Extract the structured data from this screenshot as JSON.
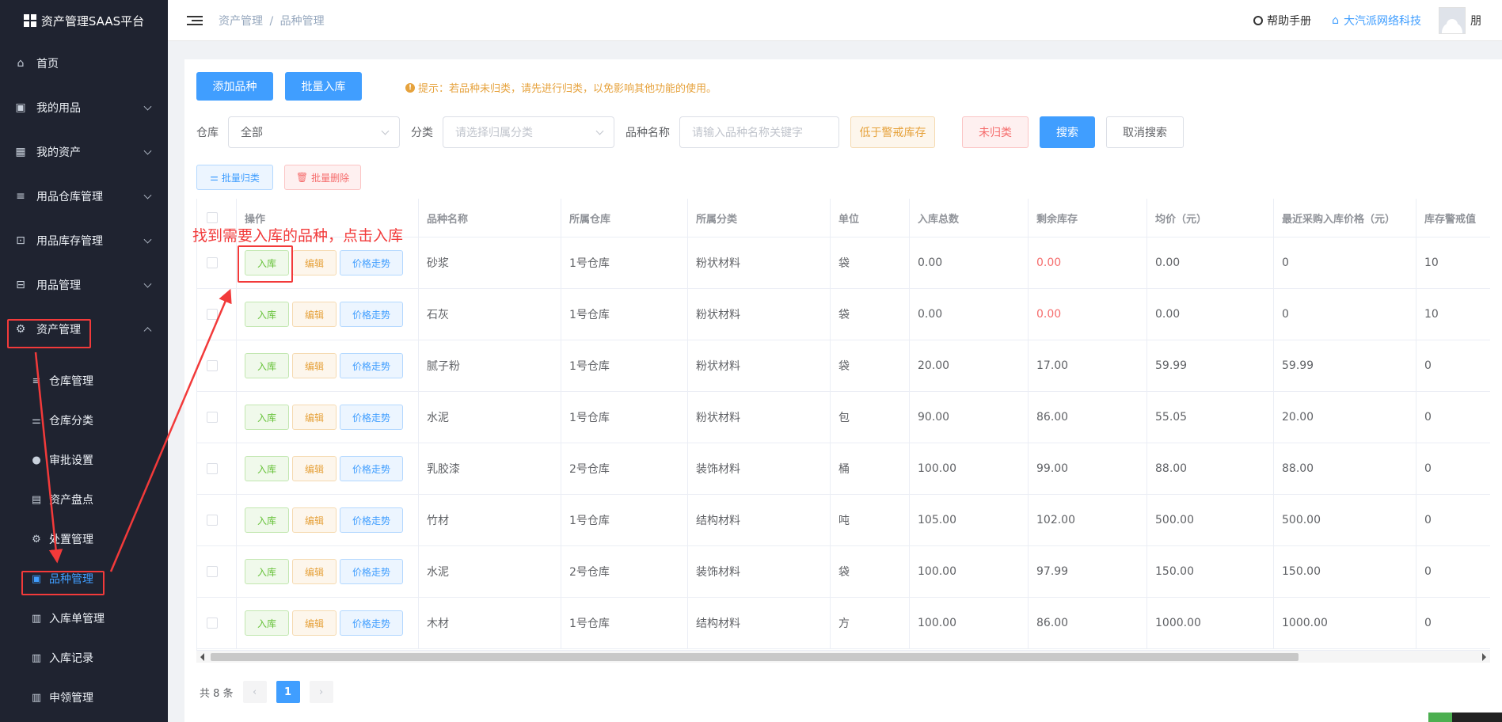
{
  "brand": {
    "title": "资产管理SAAS平台"
  },
  "sidebar": {
    "menu": [
      {
        "label": "首页",
        "icon": "home-icon",
        "chevron": ""
      },
      {
        "label": "我的用品",
        "icon": "bag-icon",
        "chevron": "down"
      },
      {
        "label": "我的资产",
        "icon": "building-icon",
        "chevron": "down"
      },
      {
        "label": "用品仓库管理",
        "icon": "database-icon",
        "chevron": "down"
      },
      {
        "label": "用品库存管理",
        "icon": "box-icon",
        "chevron": "down"
      },
      {
        "label": "用品管理",
        "icon": "tray-icon",
        "chevron": "down"
      },
      {
        "label": "资产管理",
        "icon": "gear-box-icon",
        "chevron": "up"
      }
    ],
    "submenu": [
      {
        "label": "仓库管理",
        "icon": "database-icon"
      },
      {
        "label": "仓库分类",
        "icon": "sliders-icon"
      },
      {
        "label": "审批设置",
        "icon": "user-icon"
      },
      {
        "label": "资产盘点",
        "icon": "document-icon"
      },
      {
        "label": "处置管理",
        "icon": "gear-icon"
      },
      {
        "label": "品种管理",
        "icon": "bag-icon",
        "active": true
      },
      {
        "label": "入库单管理",
        "icon": "clipboard-icon"
      },
      {
        "label": "入库记录",
        "icon": "clipboard-icon"
      },
      {
        "label": "申领管理",
        "icon": "clipboard-icon"
      }
    ]
  },
  "header": {
    "breadcrumb_parent": "资产管理",
    "breadcrumb_sep": "/",
    "breadcrumb_current": "品种管理",
    "help_label": "帮助手册",
    "company_label": "大汽派网络科技",
    "user_name": "朋"
  },
  "toolbar": {
    "add_label": "添加品种",
    "batch_in_label": "批量入库",
    "tip": "提示：若品种未归类，请先进行归类，以免影响其他功能的使用。"
  },
  "filters": {
    "warehouse_label": "仓库",
    "warehouse_value": "全部",
    "category_label": "分类",
    "category_placeholder": "请选择归属分类",
    "name_label": "品种名称",
    "name_placeholder": "请输入品种名称关键字",
    "low_stock_label": "低于警戒库存",
    "uncategorized_label": "未归类",
    "search_label": "搜索",
    "cancel_search_label": "取消搜索"
  },
  "batch": {
    "categorize_label": "批量归类",
    "delete_label": "批量删除"
  },
  "table": {
    "headers": [
      "操作",
      "品种名称",
      "所属仓库",
      "所属分类",
      "单位",
      "入库总数",
      "剩余库存",
      "均价（元）",
      "最近采购入库价格（元）",
      "库存警戒值"
    ],
    "actions": {
      "in": "入库",
      "edit": "编辑",
      "trend": "价格走势"
    },
    "rows": [
      {
        "name": "砂浆",
        "warehouse": "1号仓库",
        "category": "粉状材料",
        "unit": "袋",
        "total": "0.00",
        "remain": "0.00",
        "remain_red": true,
        "avg": "0.00",
        "last": "0",
        "alert": "10"
      },
      {
        "name": "石灰",
        "warehouse": "1号仓库",
        "category": "粉状材料",
        "unit": "袋",
        "total": "0.00",
        "remain": "0.00",
        "remain_red": true,
        "avg": "0.00",
        "last": "0",
        "alert": "10"
      },
      {
        "name": "腻子粉",
        "warehouse": "1号仓库",
        "category": "粉状材料",
        "unit": "袋",
        "total": "20.00",
        "remain": "17.00",
        "remain_red": false,
        "avg": "59.99",
        "last": "59.99",
        "alert": "0"
      },
      {
        "name": "水泥",
        "warehouse": "1号仓库",
        "category": "粉状材料",
        "unit": "包",
        "total": "90.00",
        "remain": "86.00",
        "remain_red": false,
        "avg": "55.05",
        "last": "20.00",
        "alert": "0"
      },
      {
        "name": "乳胶漆",
        "warehouse": "2号仓库",
        "category": "装饰材料",
        "unit": "桶",
        "total": "100.00",
        "remain": "99.00",
        "remain_red": false,
        "avg": "88.00",
        "last": "88.00",
        "alert": "0"
      },
      {
        "name": "竹材",
        "warehouse": "1号仓库",
        "category": "结构材料",
        "unit": "吨",
        "total": "105.00",
        "remain": "102.00",
        "remain_red": false,
        "avg": "500.00",
        "last": "500.00",
        "alert": "0"
      },
      {
        "name": "水泥",
        "warehouse": "2号仓库",
        "category": "装饰材料",
        "unit": "袋",
        "total": "100.00",
        "remain": "97.99",
        "remain_red": false,
        "avg": "150.00",
        "last": "150.00",
        "alert": "0"
      },
      {
        "name": "木材",
        "warehouse": "1号仓库",
        "category": "结构材料",
        "unit": "方",
        "total": "100.00",
        "remain": "86.00",
        "remain_red": false,
        "avg": "1000.00",
        "last": "1000.00",
        "alert": "0"
      }
    ]
  },
  "pager": {
    "total_label": "共 8 条",
    "current_page": "1",
    "prev": "‹",
    "next": "›"
  },
  "annotation": {
    "text": "找到需要入库的品种，点击入库",
    "color": "#f23a3a"
  },
  "colors": {
    "accent": "#409eff",
    "sidebar_bg": "#1f2330",
    "highlight": "#f23a3a"
  }
}
